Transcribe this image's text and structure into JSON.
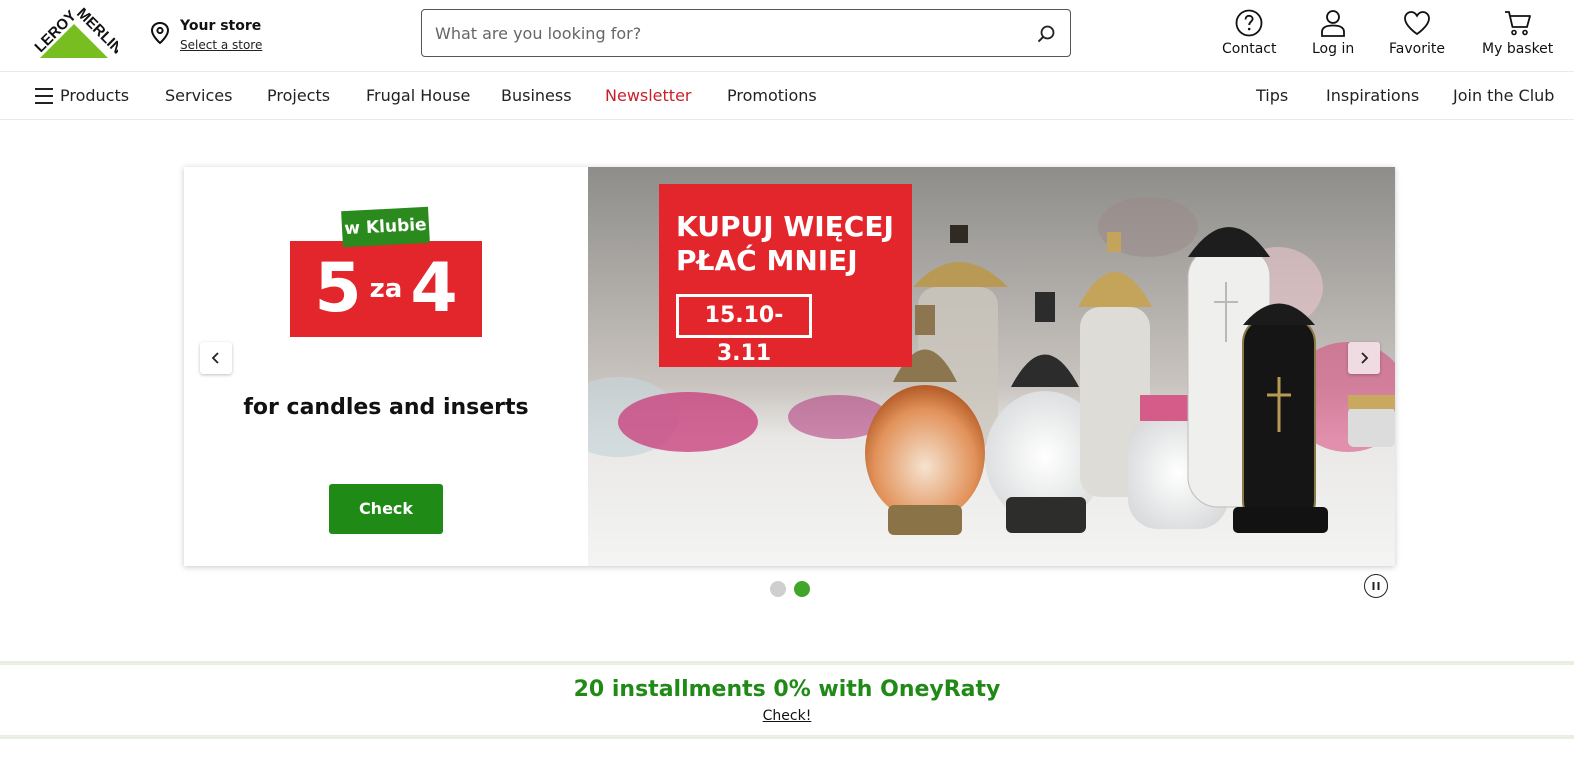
{
  "header": {
    "logo_text": "LEROY MERLIN",
    "store": {
      "title": "Your store",
      "link": "Select a store"
    },
    "search": {
      "placeholder": "What are you looking for?",
      "value": ""
    },
    "icons": [
      {
        "label": "Contact",
        "icon": "help-icon"
      },
      {
        "label": "Log in",
        "icon": "user-icon"
      },
      {
        "label": "Favorite",
        "icon": "heart-icon"
      },
      {
        "label": "My basket",
        "icon": "cart-icon"
      }
    ]
  },
  "nav": {
    "left": [
      "Products",
      "Services",
      "Projects",
      "Frugal House",
      "Business",
      "Newsletter",
      "Promotions"
    ],
    "right": [
      "Tips",
      "Inspirations",
      "Join the Club"
    ]
  },
  "carousel": {
    "badge_top": "w Klubie",
    "badge_big_left": "5",
    "badge_small": "za",
    "badge_big_right": "4",
    "text": "for candles and inserts",
    "button": "Check",
    "promo_title": "KUPUJ WIĘCEJ\nPŁAĆ MNIEJ",
    "promo_date": "15.10-3.11",
    "slides": 2,
    "active_slide": 2
  },
  "banner": {
    "title": "20 installments 0% with OneyRaty",
    "link": "Check!"
  },
  "colors": {
    "brand_green": "#78be20",
    "button_green": "#1f8a16",
    "promo_red": "#e3262b",
    "newsletter_red": "#c8202a"
  }
}
